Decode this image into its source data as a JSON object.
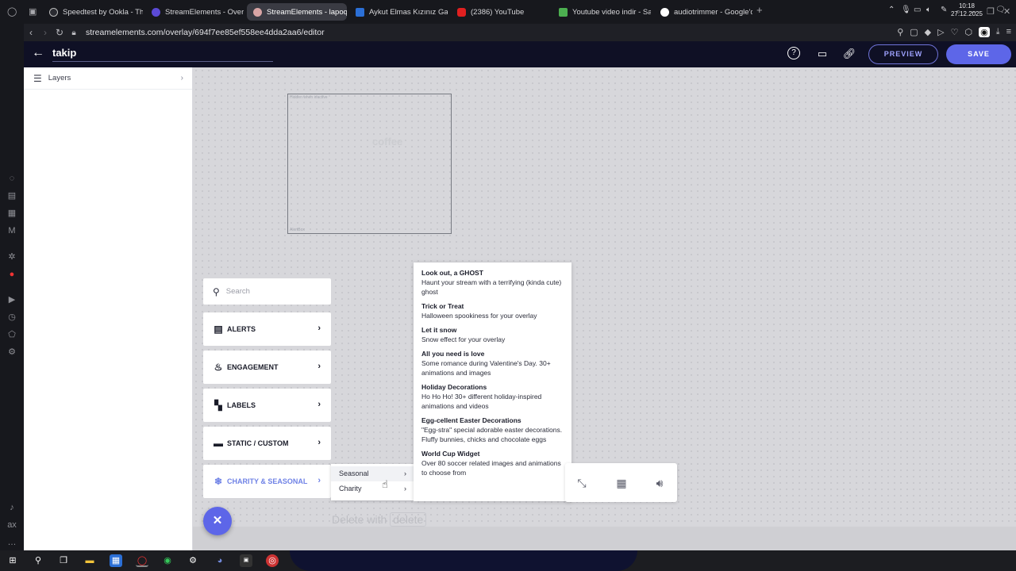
{
  "browser": {
    "tabs": [
      {
        "label": "Speedtest by Ookla - The",
        "active": false
      },
      {
        "label": "StreamElements - Overla",
        "active": false
      },
      {
        "label": "StreamElements - lapoq",
        "active": true
      },
      {
        "label": "Aykut Elmas Kızınız Galib",
        "active": false
      },
      {
        "label": "(2386) YouTube",
        "active": false
      },
      {
        "label": "Youtube video indir - Sav",
        "active": false
      },
      {
        "label": "audiotrimmer - Google'da",
        "active": false
      }
    ],
    "new_tab": "+",
    "url": "streamelements.com/overlay/694f7ee85ef558ee4dda2aa6/editor"
  },
  "editor": {
    "overlay_name": "takip",
    "preview_label": "PREVIEW",
    "save_label": "SAVE",
    "layers_label": "Layers"
  },
  "widget": {
    "top_label": "Hidden when inactive",
    "watermark": "coffee",
    "bottom_label": "AlertBox"
  },
  "widget_menu": {
    "search_placeholder": "Search",
    "categories": [
      {
        "label": "ALERTS",
        "icon": "alerts-icon"
      },
      {
        "label": "ENGAGEMENT",
        "icon": "flame-icon"
      },
      {
        "label": "LABELS",
        "icon": "labels-icon"
      },
      {
        "label": "STATIC / CUSTOM",
        "icon": "static-custom-icon"
      },
      {
        "label": "CHARITY & SEASONAL",
        "icon": "snowflake-icon"
      }
    ]
  },
  "submenu": {
    "items": [
      {
        "label": "Seasonal"
      },
      {
        "label": "Charity"
      }
    ]
  },
  "seasonal_items": [
    {
      "title": "Look out, a GHOST",
      "desc": "Haunt your stream with a terrifying (kinda cute) ghost"
    },
    {
      "title": "Trick or Treat",
      "desc": "Halloween spookiness for your overlay"
    },
    {
      "title": "Let it snow",
      "desc": "Snow effect for your overlay"
    },
    {
      "title": "All you need is love",
      "desc": "Some romance during Valentine's Day. 30+ animations and images"
    },
    {
      "title": "Holiday Decorations",
      "desc": "Ho Ho Ho! 30+ different holiday-inspired animations and videos"
    },
    {
      "title": "Egg-cellent Easter Decorations",
      "desc": "\"Egg-stra\" special adorable easter decorations. Fluffy bunnies, chicks and chocolate eggs"
    },
    {
      "title": "World Cup Widget",
      "desc": "Over 80 soccer related images and animations to choose from"
    }
  ],
  "delete_hint": {
    "text": "Delete with",
    "key": "delete"
  },
  "taskbar": {
    "time": "10:18",
    "date": "27.12.2025"
  },
  "colors": {
    "accent": "#5d66e8",
    "header_bg": "#0f1025",
    "canvas_bg": "#d7d7db",
    "selected_category": "#6f82e6"
  }
}
